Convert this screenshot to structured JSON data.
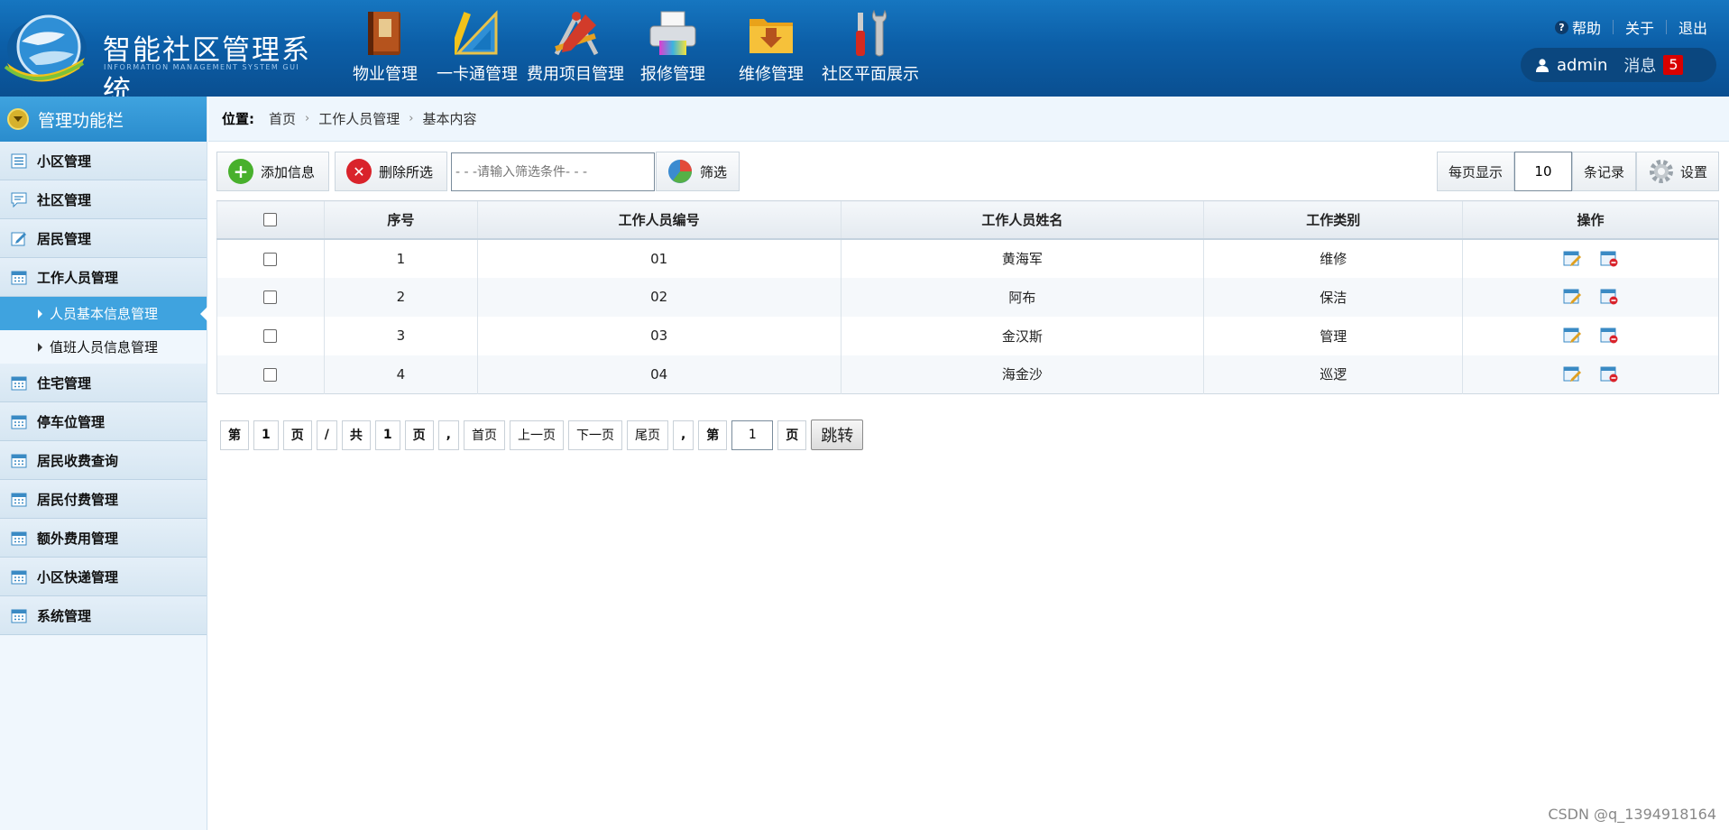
{
  "header": {
    "app_title": "智能社区管理系统",
    "app_subtitle": "INFORMATION MANAGEMENT SYSTEM GUI",
    "nav": [
      {
        "label": "物业管理",
        "icon": "book-icon"
      },
      {
        "label": "一卡通管理",
        "icon": "ruler-triangle-icon"
      },
      {
        "label": "费用项目管理",
        "icon": "compass-pencil-icon"
      },
      {
        "label": "报修管理",
        "icon": "printer-icon"
      },
      {
        "label": "维修管理",
        "icon": "folder-download-icon"
      },
      {
        "label": "社区平面展示",
        "icon": "tools-icon"
      }
    ],
    "links": {
      "help": "帮助",
      "about": "关于",
      "logout": "退出"
    },
    "user": {
      "name": "admin",
      "message_label": "消息",
      "message_count": "5"
    }
  },
  "sidebar": {
    "title": "管理功能栏",
    "items": [
      {
        "label": "小区管理",
        "icon": "list-icon"
      },
      {
        "label": "社区管理",
        "icon": "chat-icon"
      },
      {
        "label": "居民管理",
        "icon": "edit-icon"
      },
      {
        "label": "工作人员管理",
        "icon": "calendar-icon"
      }
    ],
    "sub_items": [
      {
        "label": "人员基本信息管理",
        "active": true
      },
      {
        "label": "值班人员信息管理",
        "active": false
      }
    ],
    "items_after": [
      {
        "label": "住宅管理",
        "icon": "calendar-icon"
      },
      {
        "label": "停车位管理",
        "icon": "calendar-icon"
      },
      {
        "label": "居民收费查询",
        "icon": "calendar-icon"
      },
      {
        "label": "居民付费管理",
        "icon": "calendar-icon"
      },
      {
        "label": "额外费用管理",
        "icon": "calendar-icon"
      },
      {
        "label": "小区快递管理",
        "icon": "calendar-icon"
      },
      {
        "label": "系统管理",
        "icon": "calendar-icon"
      }
    ]
  },
  "breadcrumb": {
    "label": "位置:",
    "items": [
      "首页",
      "工作人员管理",
      "基本内容"
    ]
  },
  "toolbar": {
    "add_label": "添加信息",
    "delete_label": "删除所选",
    "filter_placeholder": "- - -请输入筛选条件- - -",
    "filter_label": "筛选",
    "per_page_prefix": "每页显示",
    "per_page_value": "10",
    "per_page_suffix": "条记录",
    "settings_label": "设置"
  },
  "table": {
    "headers": [
      "序号",
      "工作人员编号",
      "工作人员姓名",
      "工作类别",
      "操作"
    ],
    "rows": [
      [
        "1",
        "01",
        "黄海军",
        "维修"
      ],
      [
        "2",
        "02",
        "阿布",
        "保洁"
      ],
      [
        "3",
        "03",
        "金汉斯",
        "管理"
      ],
      [
        "4",
        "04",
        "海金沙",
        "巡逻"
      ]
    ]
  },
  "pager": {
    "di": "第",
    "page": "1",
    "ye": "页",
    "slash": "/",
    "gong": "共",
    "total": "1",
    "comma": ",",
    "first": "首页",
    "prev": "上一页",
    "next": "下一页",
    "last": "尾页",
    "goto_value": "1",
    "jump": "跳转"
  },
  "watermark": "CSDN @q_1394918164",
  "colors": {
    "header_blue": "#0c5fa8",
    "sidebar_active": "#3fa3df",
    "badge_red": "#d90000"
  }
}
